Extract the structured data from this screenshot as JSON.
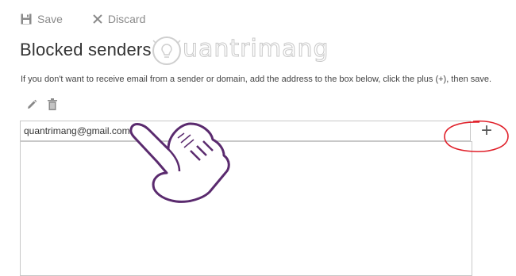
{
  "toolbar": {
    "save_label": "Save",
    "discard_label": "Discard"
  },
  "page": {
    "title": "Blocked senders",
    "description": "If you don't want to receive email from a sender or domain, add the address to the box below, click the plus (+), then save."
  },
  "watermark": {
    "text": "uantrimang"
  },
  "entry": {
    "value": "quantrimang@gmail.com",
    "add_label": "+"
  },
  "blocked_list": {
    "items": []
  },
  "icons": {
    "save": "save-icon",
    "discard": "close-icon",
    "edit": "pencil-icon",
    "delete": "trash-icon",
    "watermark": "bulb-icon"
  },
  "colors": {
    "toolbar_text": "#8a8a8a",
    "annotation_red": "#e0202a",
    "annotation_purple": "#5a2a6e",
    "border": "#c8c8c8"
  }
}
